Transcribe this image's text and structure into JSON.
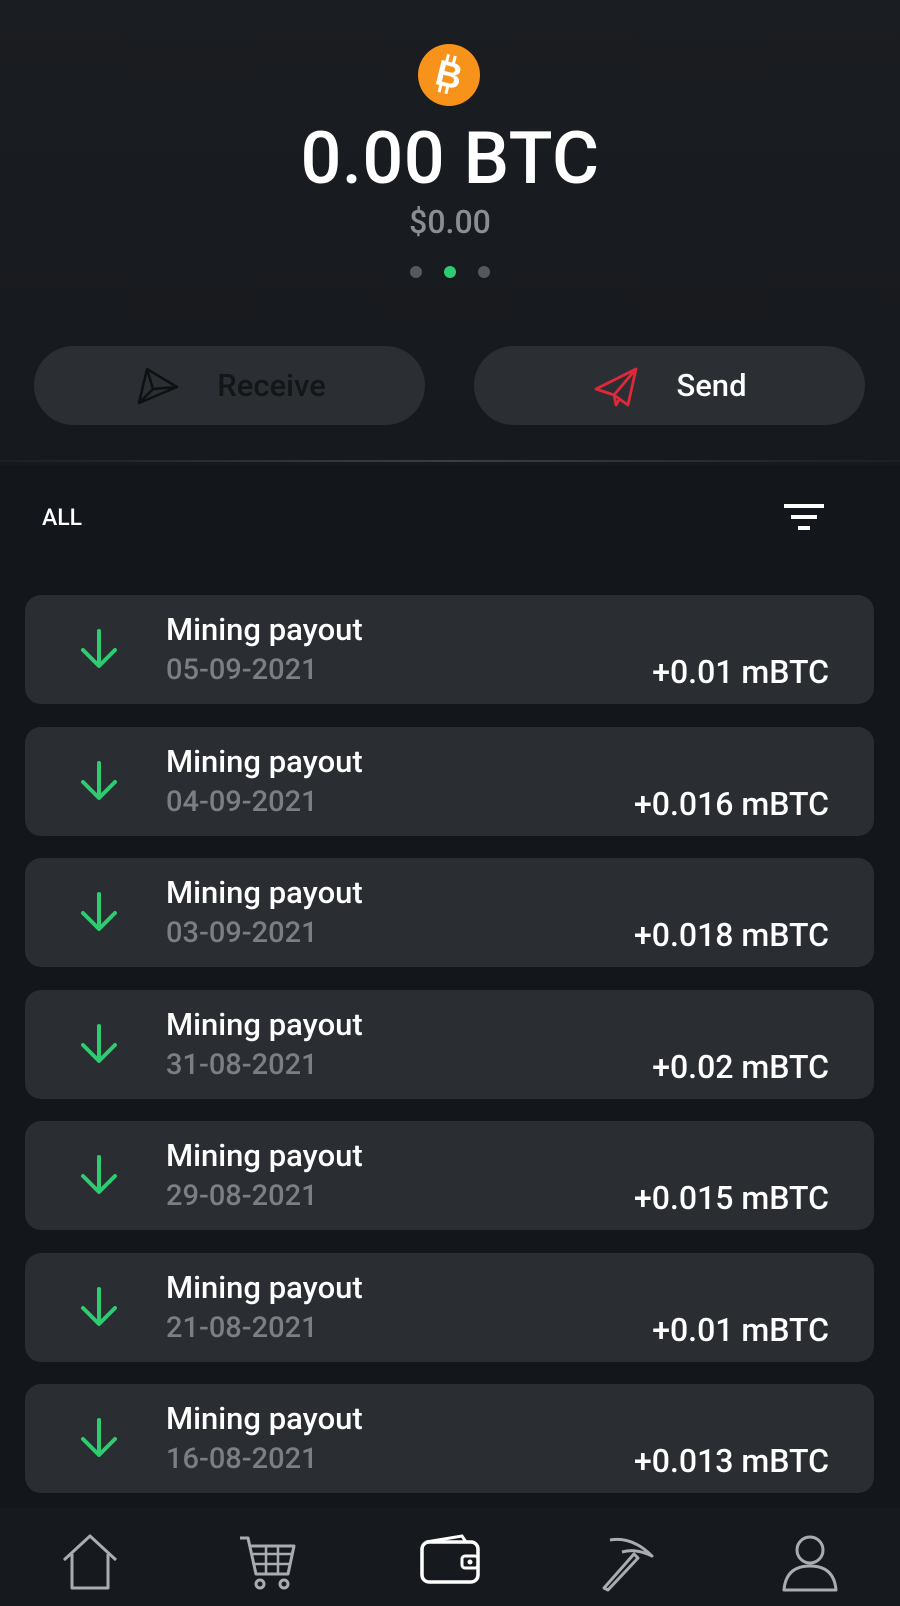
{
  "wallet": {
    "coin_icon": "bitcoin-icon",
    "balance": "0.00 BTC",
    "fiat_value": "$0.00",
    "pager_dots": 3,
    "pager_active": 1
  },
  "actions": {
    "receive_label": "Receive",
    "send_label": "Send"
  },
  "filter": {
    "label": "ALL",
    "icon": "filter-icon"
  },
  "transactions": [
    {
      "title": "Mining payout",
      "date": "05-09-2021",
      "amount": "+0.01 mBTC"
    },
    {
      "title": "Mining payout",
      "date": "04-09-2021",
      "amount": "+0.016 mBTC"
    },
    {
      "title": "Mining payout",
      "date": "03-09-2021",
      "amount": "+0.018 mBTC"
    },
    {
      "title": "Mining payout",
      "date": "31-08-2021",
      "amount": "+0.02 mBTC"
    },
    {
      "title": "Mining payout",
      "date": "29-08-2021",
      "amount": "+0.015 mBTC"
    },
    {
      "title": "Mining payout",
      "date": "21-08-2021",
      "amount": "+0.01 mBTC"
    },
    {
      "title": "Mining payout",
      "date": "16-08-2021",
      "amount": "+0.013 mBTC"
    }
  ],
  "nav": [
    "home-icon",
    "cart-icon",
    "wallet-icon",
    "pickaxe-icon",
    "profile-icon"
  ],
  "colors": {
    "background": "#13161a",
    "card": "#2a2d31",
    "accent_green": "#2ecc71",
    "bitcoin_orange": "#f7931a",
    "send_red": "#e0283a"
  }
}
